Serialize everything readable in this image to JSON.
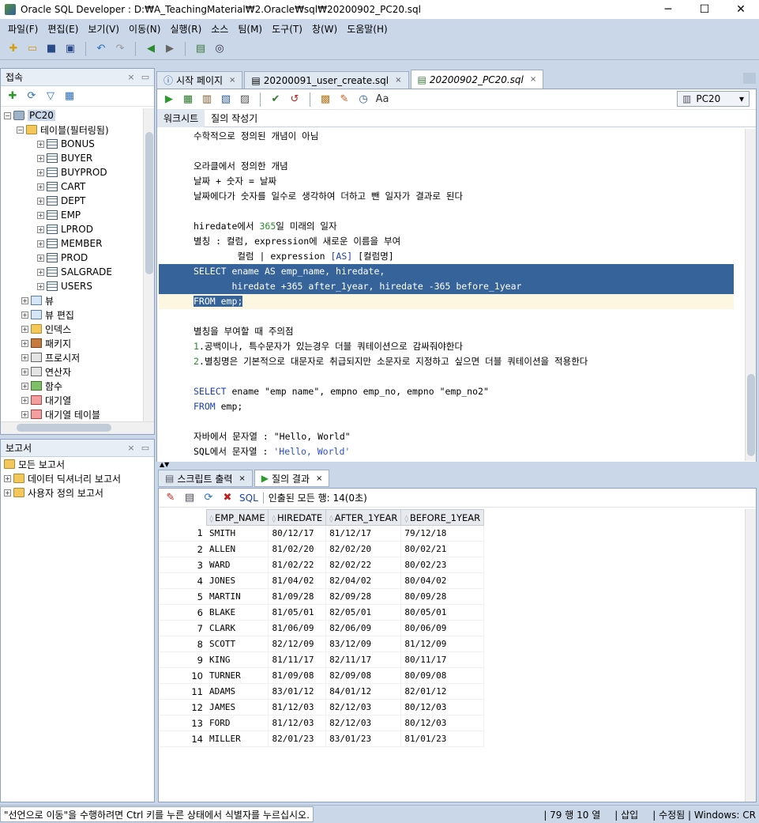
{
  "window": {
    "title": "Oracle SQL Developer : D:₩A_TeachingMaterial₩2.Oracle₩sql₩20200902_PC20.sql"
  },
  "menu": [
    "파일(F)",
    "편집(E)",
    "보기(V)",
    "이동(N)",
    "실행(R)",
    "소스",
    "팀(M)",
    "도구(T)",
    "창(W)",
    "도움말(H)"
  ],
  "connections": {
    "title": "접속",
    "root": "PC20",
    "tables_folder": "테이블(필터링됨)",
    "tables": [
      "BONUS",
      "BUYER",
      "BUYPROD",
      "CART",
      "DEPT",
      "EMP",
      "LPROD",
      "MEMBER",
      "PROD",
      "SALGRADE",
      "USERS"
    ],
    "folders": [
      "뷰",
      "뷰 편집",
      "인덱스",
      "패키지",
      "프로시저",
      "연산자",
      "함수",
      "대기열",
      "대기열 테이블"
    ]
  },
  "reports": {
    "title": "보고서",
    "items": [
      "모든 보고서",
      "데이터 딕셔너리 보고서",
      "사용자 정의 보고서"
    ]
  },
  "editor": {
    "tabs": [
      {
        "label": "시작 페이지"
      },
      {
        "label": "20200091_user_create.sql"
      },
      {
        "label": "20200902_PC20.sql"
      }
    ],
    "connection": "PC20",
    "subtabs": [
      "워크시트",
      "질의 작성기"
    ],
    "lines": [
      "수학적으로 정의된 개념이 아님",
      "",
      "오라클에서 정의한 개념",
      "날짜 + 숫자 = 날짜",
      "날짜에다가 숫자를 일수로 생각하여 더하고 뺀 일자가 결과로 된다",
      "",
      "hiredate에서 365일 미래의 일자",
      "별칭 : 컬럼, expression에 새로운 이름을 부여",
      "        컬럼 | expression [AS] [컬럼명]",
      "SELECT ename AS emp_name, hiredate,",
      "       hiredate +365 after_1year, hiredate -365 before_1year",
      "FROM emp;",
      "",
      "별칭을 부여할 때 주의점",
      "1.공백이나, 특수문자가 있는경우 더블 쿼테이션으로 감싸줘야한다",
      "2.별칭명은 기본적으로 대문자로 취급되지만 소문자로 지정하고 싶으면 더블 쿼테이션을 적용한다",
      "",
      "SELECT ename \"emp name\", empno emp_no, empno \"emp_no2\"",
      "FROM emp;",
      "",
      "자바에서 문자열 : \"Hello, World\"",
      "SQL에서 문자열 : 'Hello, World'"
    ]
  },
  "results": {
    "tabs": [
      "스크립트 출력",
      "질의 결과"
    ],
    "sql_label": "SQL",
    "fetched": "인출된 모든 행: 14(0초)",
    "columns": [
      "EMP_NAME",
      "HIREDATE",
      "AFTER_1YEAR",
      "BEFORE_1YEAR"
    ],
    "rows": [
      [
        "1",
        "SMITH",
        "80/12/17",
        "81/12/17",
        "79/12/18"
      ],
      [
        "2",
        "ALLEN",
        "81/02/20",
        "82/02/20",
        "80/02/21"
      ],
      [
        "3",
        "WARD",
        "81/02/22",
        "82/02/22",
        "80/02/23"
      ],
      [
        "4",
        "JONES",
        "81/04/02",
        "82/04/02",
        "80/04/02"
      ],
      [
        "5",
        "MARTIN",
        "81/09/28",
        "82/09/28",
        "80/09/28"
      ],
      [
        "6",
        "BLAKE",
        "81/05/01",
        "82/05/01",
        "80/05/01"
      ],
      [
        "7",
        "CLARK",
        "81/06/09",
        "82/06/09",
        "80/06/09"
      ],
      [
        "8",
        "SCOTT",
        "82/12/09",
        "83/12/09",
        "81/12/09"
      ],
      [
        "9",
        "KING",
        "81/11/17",
        "82/11/17",
        "80/11/17"
      ],
      [
        "10",
        "TURNER",
        "81/09/08",
        "82/09/08",
        "80/09/08"
      ],
      [
        "11",
        "ADAMS",
        "83/01/12",
        "84/01/12",
        "82/01/12"
      ],
      [
        "12",
        "JAMES",
        "81/12/03",
        "82/12/03",
        "80/12/03"
      ],
      [
        "13",
        "FORD",
        "81/12/03",
        "82/12/03",
        "80/12/03"
      ],
      [
        "14",
        "MILLER",
        "82/01/23",
        "83/01/23",
        "81/01/23"
      ]
    ]
  },
  "status": {
    "message": "\"선언으로 이동\"을 수행하려면 Ctrl 키를 누른 상태에서 식별자를 누르십시오.",
    "position": "79 행 10 열",
    "mode": "삽입",
    "modified": "수정됨",
    "eol": "Windows: CR"
  },
  "icons": {
    "app": "sql-developer-icon",
    "run": "run-statement-icon",
    "script": "run-script-icon"
  }
}
